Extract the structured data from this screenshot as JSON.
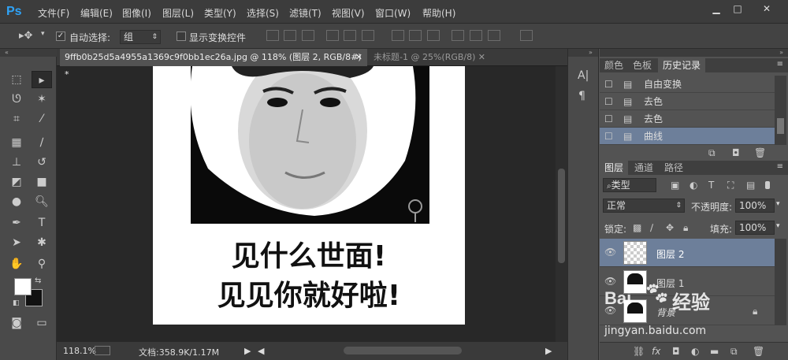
{
  "app": {
    "logo": "Ps"
  },
  "menu": [
    "文件(F)",
    "编辑(E)",
    "图像(I)",
    "图层(L)",
    "类型(Y)",
    "选择(S)",
    "滤镜(T)",
    "视图(V)",
    "窗口(W)",
    "帮助(H)"
  ],
  "window_controls": [
    "minimize-icon",
    "restore-icon",
    "close-icon"
  ],
  "options": {
    "auto_select_label": "自动选择:",
    "auto_select_value": "组",
    "show_transform_label": "显示变换控件"
  },
  "tabs": [
    {
      "label": "9ffb0b25d5a4955a1369c9f0bb1ec26a.jpg @ 118% (图层 2, RGB/8#) *",
      "active": true
    },
    {
      "label": "未标题-1 @ 25%(RGB/8)",
      "active": false
    }
  ],
  "canvas": {
    "caption_line1": "见什么世面!",
    "caption_line2": "见见你就好啦!"
  },
  "status": {
    "zoom": "118.1%",
    "doc_info": "文档:358.9K/1.17M"
  },
  "history_panel": {
    "tabs": [
      "颜色",
      "色板",
      "历史记录"
    ],
    "active_tab": "历史记录",
    "items": [
      "自由变换",
      "去色",
      "去色",
      "曲线"
    ],
    "selected_index": 3
  },
  "layers_panel": {
    "tabs": [
      "图层",
      "通道",
      "路径"
    ],
    "active_tab": "图层",
    "filter_kind": "类型",
    "blend_mode": "正常",
    "opacity_label": "不透明度:",
    "opacity_value": "100%",
    "lock_label": "锁定:",
    "fill_label": "填充:",
    "fill_value": "100%",
    "layers": [
      {
        "name": "图层 2",
        "selected": true
      },
      {
        "name": "图层 1",
        "selected": false
      },
      {
        "name": "背景",
        "selected": false
      }
    ]
  },
  "watermark": {
    "brand": "Bai",
    "text": "经验",
    "url": "jingyan.baidu.com"
  },
  "colors": {
    "accent": "#2fa3f7",
    "selection": "#6d7f9a",
    "panel_bg": "#535353"
  }
}
